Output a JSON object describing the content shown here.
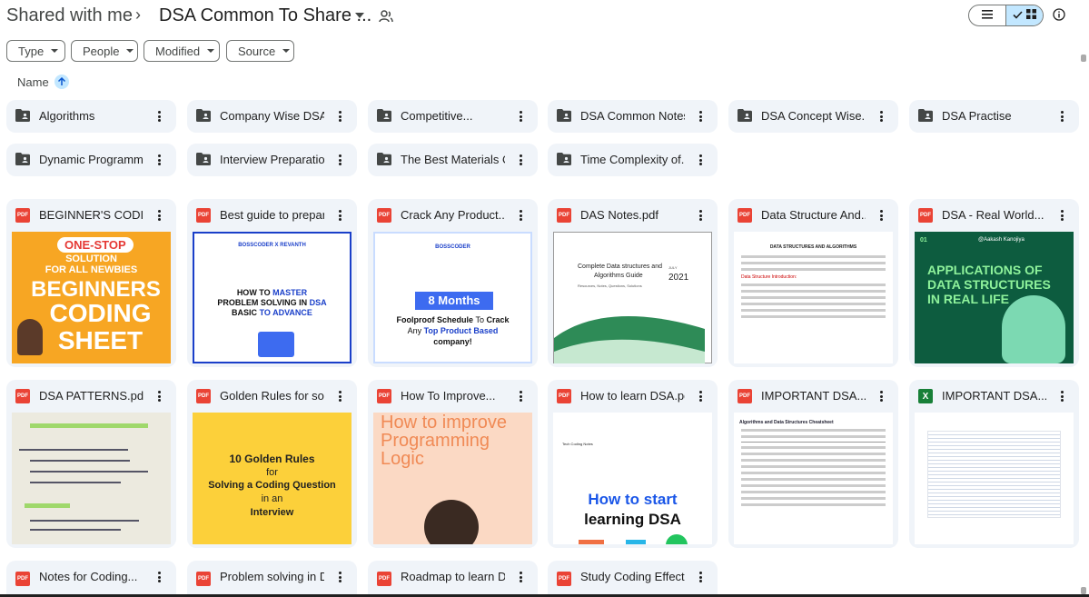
{
  "header": {
    "breadcrumb_root": "Shared with me",
    "breadcrumb_current": "DSA Common To Share ...",
    "view_list_icon": "list-view-icon",
    "view_grid_icon": "grid-view-icon",
    "info_icon": "info-icon"
  },
  "filters": [
    "Type",
    "People",
    "Modified",
    "Source"
  ],
  "sort": {
    "label": "Name"
  },
  "folders": [
    "Algorithms",
    "Company Wise DSA...",
    "Competitive...",
    "DSA Common Notes",
    "DSA Concept Wise...",
    "DSA Practise",
    "Dynamic Programming",
    "Interview Preparation",
    "The Best Materials On...",
    "Time Complexity of..."
  ],
  "files": [
    {
      "name": "BEGINNER'S CODING...",
      "type": "pdf"
    },
    {
      "name": "Best guide to prepare...",
      "type": "pdf"
    },
    {
      "name": "Crack Any Product...",
      "type": "pdf"
    },
    {
      "name": "DAS Notes.pdf",
      "type": "pdf"
    },
    {
      "name": "Data Structure And...",
      "type": "pdf"
    },
    {
      "name": "DSA - Real World...",
      "type": "pdf"
    },
    {
      "name": "DSA PATTERNS.pdf",
      "type": "pdf"
    },
    {
      "name": "Golden Rules for solvin...",
      "type": "pdf"
    },
    {
      "name": "How To Improve...",
      "type": "pdf"
    },
    {
      "name": "How to learn DSA.pdf",
      "type": "pdf"
    },
    {
      "name": "IMPORTANT DSA...",
      "type": "pdf"
    },
    {
      "name": "IMPORTANT DSA...",
      "type": "xls"
    },
    {
      "name": "Notes for Coding...",
      "type": "pdf"
    },
    {
      "name": "Problem solving in DS...",
      "type": "pdf"
    },
    {
      "name": "Roadmap to learn DSA...",
      "type": "pdf"
    },
    {
      "name": "Study Coding Effective...",
      "type": "pdf"
    }
  ],
  "thumbs": {
    "t1": {
      "top": "ONE-STOP",
      "sub1": "SOLUTION",
      "sub2": "FOR ALL NEWBIES",
      "big1": "BEGINNERS",
      "big2": "CODING",
      "big3": "SHEET"
    },
    "t2": {
      "brand": "BOSSCODER",
      "x": "X",
      "partner": "REVANTH",
      "l1": "HOW TO",
      "l1b": "MASTER",
      "l2": "PROBLEM SOLVING IN",
      "l2b": "DSA",
      "l3": "BASIC",
      "l3b": "TO",
      "l3c": "ADVANCE"
    },
    "t3": {
      "brand": "BOSSCODER",
      "big": "8 Months",
      "l1": "Foolproof Schedule",
      "l1b": "To",
      "l1c": "Crack",
      "l2": "Any",
      "l2b": "Top Product Based",
      "l3": "company!"
    },
    "t4": {
      "l1": "Complete Data structures and",
      "l2": "Algorithms Guide",
      "l3": "Resources, Notes, Questions, Solutions",
      "month": "JULY",
      "year": "2021"
    },
    "t5": {
      "heading": "DATA STRUCTURES AND ALGORITHMS",
      "sub": "Data Structure Introduction:"
    },
    "t6": {
      "num": "01",
      "author": "@Aakash Kanojiya",
      "l1": "APPLICATIONS OF",
      "l2": "DATA STRUCTURES",
      "l3": "IN REAL LIFE"
    },
    "t8": {
      "l1": "10 Golden Rules",
      "l2": "for",
      "l3": "Solving a Coding Question",
      "l4": "in an",
      "l5": "Interview"
    },
    "t9": {
      "l1": "How to improve",
      "l2": "Programming",
      "l3": "Logic"
    },
    "t10": {
      "brand": "Tech Coding Notes",
      "l1": "How to start",
      "l2": "learning DSA"
    },
    "t11": {
      "heading": "Algorithms and Data Structures Cheatsheet"
    }
  },
  "colors": {
    "accent": "#0b57d0",
    "chip_active": "#c2e7ff",
    "card_bg": "#f0f4f9"
  }
}
